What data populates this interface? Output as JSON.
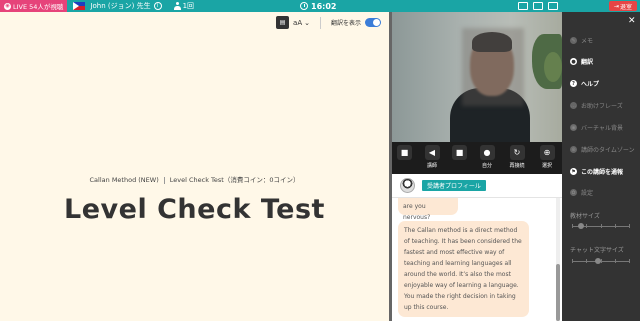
{
  "topbar": {
    "live_label": "LIVE 54人が視聴",
    "teacher_name": "John (ジョン) 先生",
    "lesson_count": "1回",
    "timer": "16:02",
    "exit_label": "退室"
  },
  "toolbar": {
    "font_size_label": "aA",
    "translation_label": "翻訳を表示",
    "translation_on": true
  },
  "lesson": {
    "course": "Callan Method (NEW)",
    "level_info": "Level Check Test（消費コイン：0コイン）",
    "title": "Level Check Test"
  },
  "video_controls": [
    {
      "icon": "camera-icon",
      "label": ""
    },
    {
      "icon": "volume-icon",
      "label": "講師"
    },
    {
      "icon": "camera-icon",
      "label": ""
    },
    {
      "icon": "mic-icon",
      "label": "自分"
    },
    {
      "icon": "reconnect-icon",
      "label": "再接続"
    },
    {
      "icon": "globe-icon",
      "label": "選択"
    }
  ],
  "profile": {
    "button_label": "受講者プロフィール"
  },
  "chat": {
    "messages": [
      "are you nervous?",
      "The Callan method is a direct method of teaching. It has been considered the fastest and most effective way of teaching and learning languages all around the world. It’s also the most enjoyable way of learning a language. You made the right decision in taking up this course."
    ]
  },
  "sidebar": {
    "close_icon": "close-icon",
    "items": [
      {
        "label": "メモ",
        "icon": "pencil-icon",
        "active": false
      },
      {
        "label": "翻訳",
        "icon": "translate-icon",
        "active": true
      },
      {
        "label": "ヘルプ",
        "icon": "help-icon",
        "active": true
      },
      {
        "label": "お助けフレーズ",
        "icon": "chat-icon",
        "active": false
      },
      {
        "label": "バーチャル背景",
        "icon": "image-icon",
        "active": false
      },
      {
        "label": "講師のタイムゾーン",
        "icon": "globe-icon",
        "active": false
      },
      {
        "label": "この講師を通報",
        "icon": "flag-icon",
        "active": true
      },
      {
        "label": "設定",
        "icon": "gear-icon",
        "active": false
      }
    ],
    "sliders": [
      {
        "label": "教材サイズ",
        "value": 0.15
      },
      {
        "label": "チャット文字サイズ",
        "value": 0.45
      }
    ]
  },
  "colors": {
    "topbar": "#1aa5a5",
    "live": "#e6437a",
    "exit": "#e64545",
    "toggle": "#3b7dd8",
    "bubble": "#fde8d4",
    "sidebar": "#333333"
  }
}
